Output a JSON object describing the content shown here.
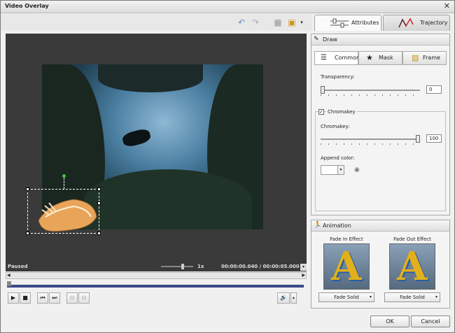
{
  "window": {
    "title": "Video Overlay",
    "close_glyph": "✕"
  },
  "tabs": [
    {
      "label": "Attributes",
      "icon": "attributes-icon"
    },
    {
      "label": "Trajectory",
      "icon": "trajectory-icon"
    }
  ],
  "status": {
    "state": "Paused",
    "speed": "1x",
    "time": "00:00:00.040 / 00:00:05.000",
    "speed_fraction": 0.68
  },
  "draw": {
    "header": "Draw",
    "subtabs": [
      "Common",
      "Mask",
      "Frame"
    ],
    "transparency_label": "Transparency:",
    "transparency_value": "0",
    "chromakey_group_label": "Chromakey",
    "chromakey_checked": "✓",
    "chromakey_label": "Chromakey:",
    "chromakey_value": "100",
    "append_color_label": "Append color:"
  },
  "animation": {
    "header": "Animation",
    "fade_in_label": "Fade In Effect",
    "fade_out_label": "Fade Out Effect",
    "fade_in_value": "Fade Solid",
    "fade_out_value": "Fade Solid",
    "preview_letter": "A"
  },
  "buttons": {
    "ok": "OK",
    "cancel": "Cancel"
  },
  "player": {
    "play": "▶",
    "stop": "■",
    "prev": "⏮",
    "next": "⏭"
  }
}
